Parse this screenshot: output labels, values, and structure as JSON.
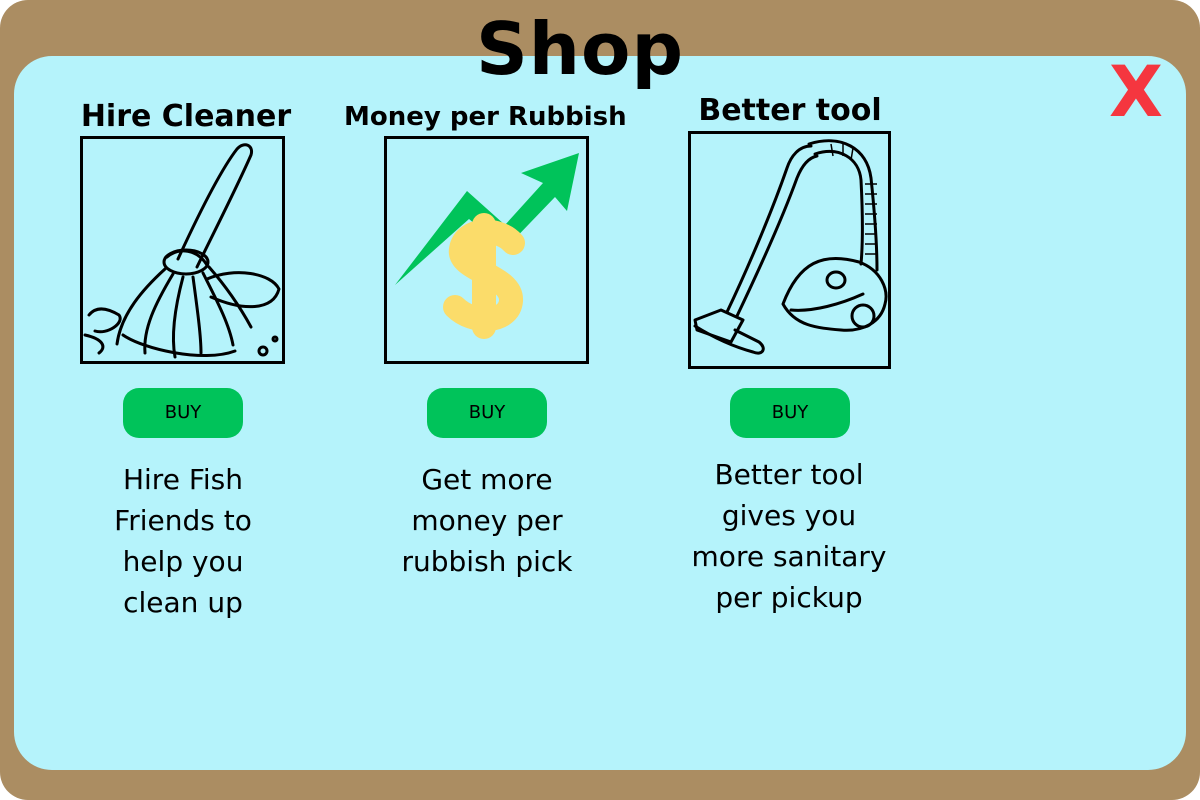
{
  "window": {
    "title": "Shop",
    "close_label": "X"
  },
  "items": [
    {
      "title": "Hire Cleaner",
      "icon": "mop-icon",
      "buy_label": "BUY",
      "description_lines": [
        "Hire Fish",
        "Friends to",
        "help you",
        "clean up"
      ]
    },
    {
      "title": "Money per Rubbish",
      "icon": "money-growth-icon",
      "buy_label": "BUY",
      "description_lines": [
        "Get more",
        "money per",
        "rubbish pick"
      ]
    },
    {
      "title": "Better tool",
      "icon": "vacuum-cleaner-icon",
      "buy_label": "BUY",
      "description_lines": [
        "Better tool",
        "gives you",
        "more sanitary",
        "per pickup"
      ]
    }
  ],
  "colors": {
    "frame": "#ab8d62",
    "panel": "#b5f3fb",
    "buy_button": "#00c35a",
    "close": "#f5363f",
    "arrow": "#00c35a",
    "dollar": "#fbdc6a"
  }
}
